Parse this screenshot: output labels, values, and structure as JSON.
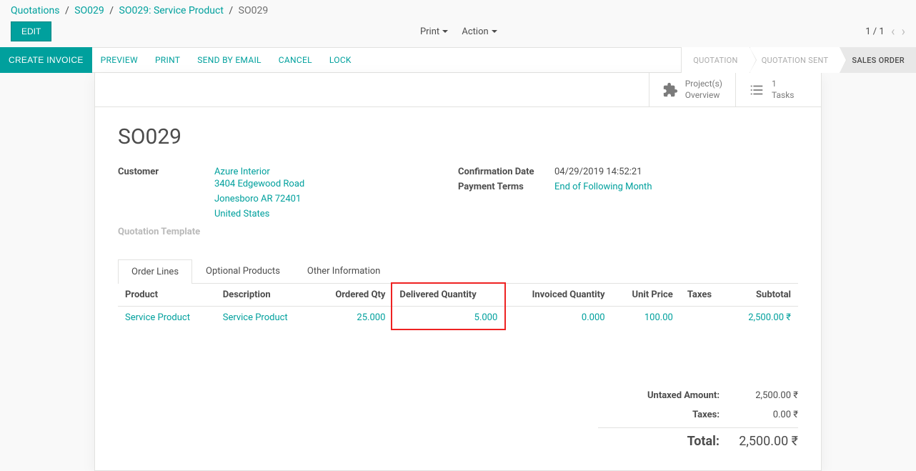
{
  "breadcrumb": {
    "items": [
      "Quotations",
      "SO029",
      "SO029: Service Product"
    ],
    "current": "SO029"
  },
  "buttons": {
    "edit": "EDIT",
    "create_invoice": "CREATE INVOICE",
    "preview": "PREVIEW",
    "print": "PRINT",
    "send_email": "SEND BY EMAIL",
    "cancel": "CANCEL",
    "lock": "LOCK"
  },
  "menus": {
    "print": "Print",
    "action": "Action"
  },
  "pager": {
    "current": "1",
    "total": "1"
  },
  "status": {
    "quotation": "QUOTATION",
    "quotation_sent": "QUOTATION SENT",
    "sales_order": "SALES ORDER"
  },
  "stats": {
    "projects": {
      "line1": "Project(s)",
      "line2": "Overview"
    },
    "tasks": {
      "count": "1",
      "label": "Tasks"
    }
  },
  "record": {
    "title": "SO029",
    "customer_label": "Customer",
    "customer_name": "Azure Interior",
    "address1": "3404 Edgewood Road",
    "address2": "Jonesboro AR 72401",
    "country": "United States",
    "quotation_template_label": "Quotation Template",
    "confirmation_date_label": "Confirmation Date",
    "confirmation_date": "04/29/2019 14:52:21",
    "payment_terms_label": "Payment Terms",
    "payment_terms": "End of Following Month"
  },
  "tabs": {
    "order_lines": "Order Lines",
    "optional_products": "Optional Products",
    "other_information": "Other Information"
  },
  "table": {
    "headers": {
      "product": "Product",
      "description": "Description",
      "ordered_qty": "Ordered Qty",
      "delivered_qty": "Delivered Quantity",
      "invoiced_qty": "Invoiced Quantity",
      "unit_price": "Unit Price",
      "taxes": "Taxes",
      "subtotal": "Subtotal"
    },
    "rows": [
      {
        "product": "Service Product",
        "description": "Service Product",
        "ordered_qty": "25.000",
        "delivered_qty": "5.000",
        "invoiced_qty": "0.000",
        "unit_price": "100.00",
        "taxes": "",
        "subtotal": "2,500.00 ₹"
      }
    ]
  },
  "totals": {
    "untaxed_label": "Untaxed Amount:",
    "untaxed_value": "2,500.00 ₹",
    "taxes_label": "Taxes:",
    "taxes_value": "0.00 ₹",
    "total_label": "Total:",
    "total_value": "2,500.00 ₹"
  }
}
